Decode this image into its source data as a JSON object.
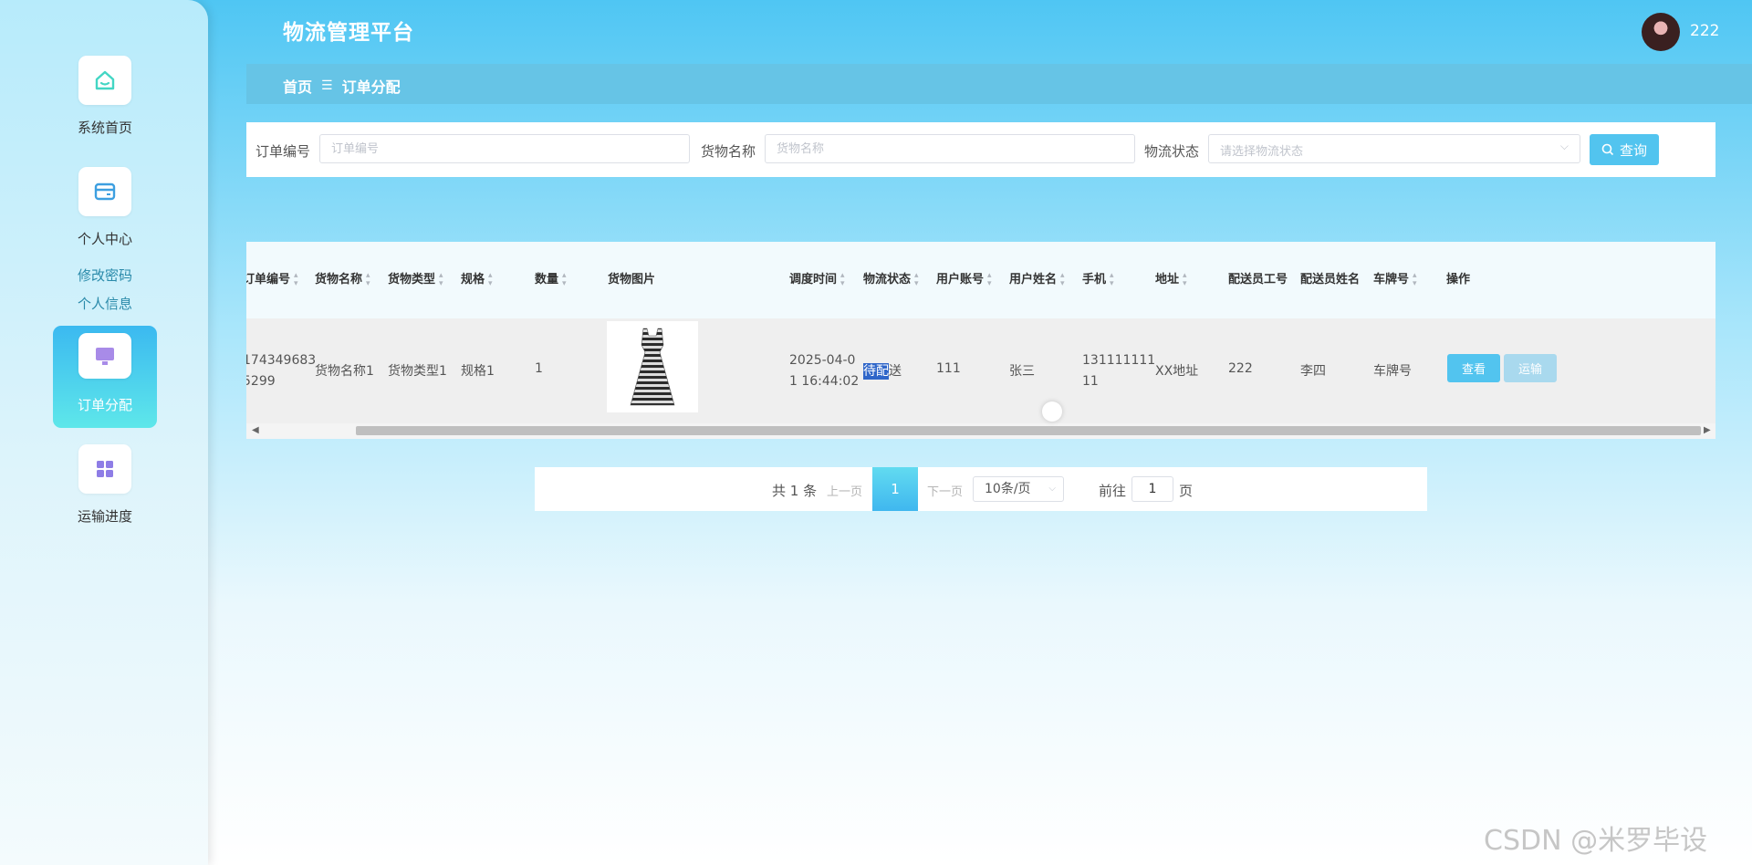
{
  "app": {
    "title": "物流管理平台"
  },
  "user": {
    "name": "222"
  },
  "sidebar": {
    "items": [
      {
        "label": "系统首页",
        "icon": "home-icon"
      },
      {
        "label": "个人中心",
        "icon": "card-icon"
      },
      {
        "label": "订单分配",
        "icon": "monitor-icon",
        "active": true
      },
      {
        "label": "运输进度",
        "icon": "grid-icon"
      }
    ],
    "sub_items": [
      "修改密码",
      "个人信息"
    ]
  },
  "breadcrumb": {
    "home": "首页",
    "separator_icon": "menu-icon",
    "current": "订单分配"
  },
  "search": {
    "order_no_label": "订单编号",
    "order_no_placeholder": "订单编号",
    "goods_name_label": "货物名称",
    "goods_name_placeholder": "货物名称",
    "status_label": "物流状态",
    "status_placeholder": "请选择物流状态",
    "query_label": "查询"
  },
  "table": {
    "columns": [
      "订单编号",
      "货物名称",
      "货物类型",
      "规格",
      "数量",
      "货物图片",
      "调度时间",
      "物流状态",
      "用户账号",
      "用户姓名",
      "手机",
      "地址",
      "配送员工号",
      "配送员姓名",
      "车牌号",
      "操作"
    ],
    "rows": [
      {
        "order_no_line1": "174349683",
        "order_no_line2": "5299",
        "goods_name": "货物名称1",
        "goods_type": "货物类型1",
        "spec": "规格1",
        "qty": "1",
        "image": "dress-image",
        "time_line1": "2025-04-0",
        "time_line2": "1 16:44:02",
        "status_highlight": "待配",
        "status_rest": "送",
        "account": "111",
        "user_name": "张三",
        "phone_line1": "131111111",
        "phone_line2": "11",
        "address": "XX地址",
        "courier_no": "222",
        "courier_name": "李四",
        "plate": "车牌号",
        "actions": {
          "view": "查看",
          "transport": "运输"
        }
      }
    ]
  },
  "pagination": {
    "total": "共 1 条",
    "prev": "上一页",
    "current": "1",
    "next": "下一页",
    "page_size": "10条/页",
    "goto_label": "前往",
    "goto_value": "1",
    "goto_unit": "页"
  },
  "watermark": "CSDN @米罗毕设",
  "colors": {
    "accent": "#52c4ef",
    "status_chip": "#2f66c9",
    "breadcrumb_bar": "#66c4e6"
  }
}
